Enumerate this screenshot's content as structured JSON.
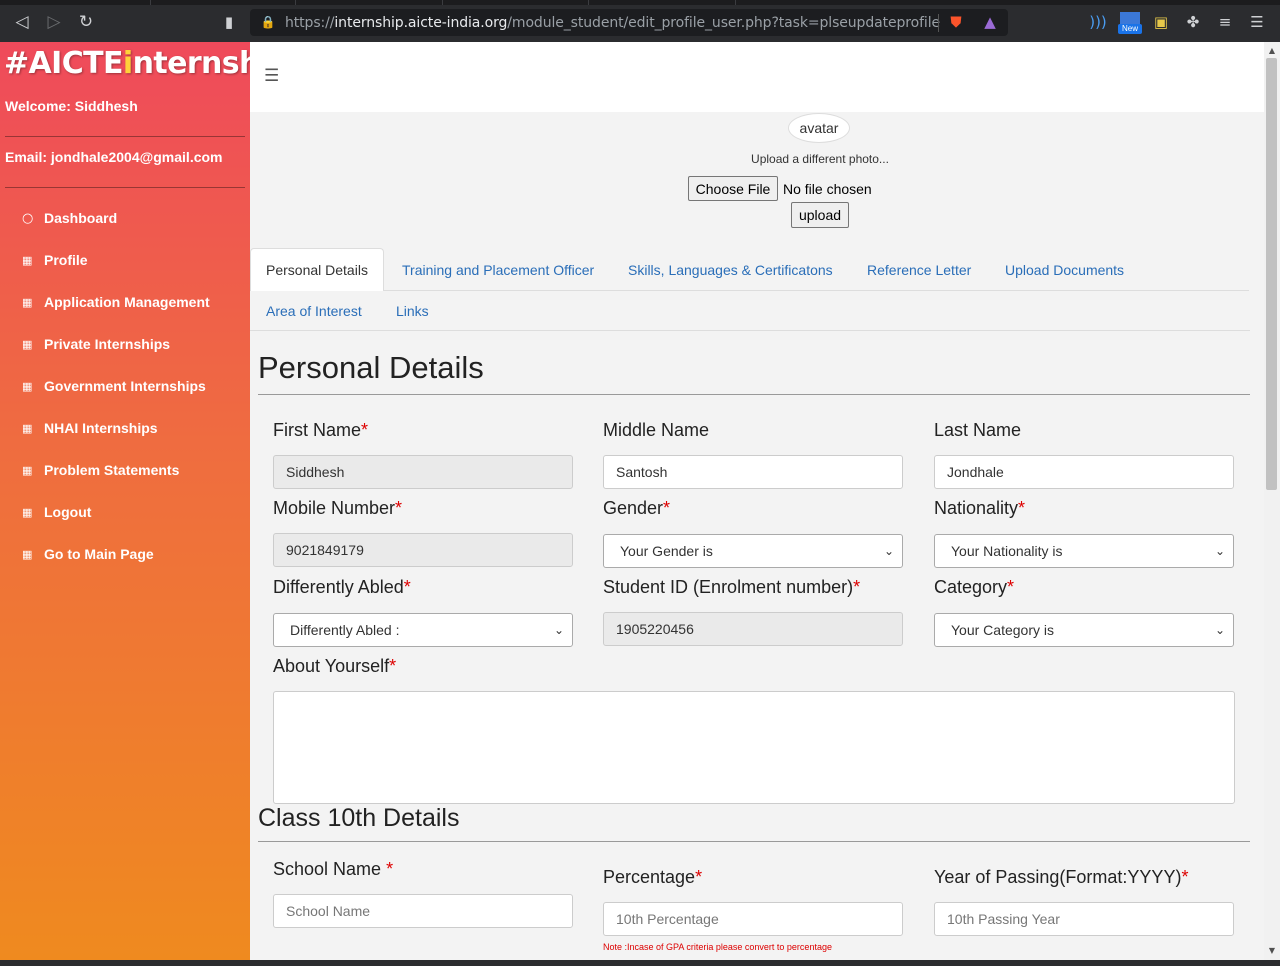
{
  "browser": {
    "url_scheme": "https://",
    "url_host": "internship.aicte-india.org",
    "url_path": "/module_student/edit_profile_user.php?task=plseupdateprofile",
    "ext_new_badge": "New"
  },
  "sidebar": {
    "logo_prefix": "#AICTE",
    "logo_i": "i",
    "logo_suffix": "nternship",
    "welcome": "Welcome: Siddhesh",
    "email": "Email: jondhale2004@gmail.com",
    "items": [
      {
        "label": "Dashboard"
      },
      {
        "label": "Profile"
      },
      {
        "label": "Application Management"
      },
      {
        "label": "Private Internships"
      },
      {
        "label": "Government Internships"
      },
      {
        "label": "NHAI Internships"
      },
      {
        "label": "Problem Statements"
      },
      {
        "label": "Logout"
      },
      {
        "label": "Go to Main Page"
      }
    ]
  },
  "profile": {
    "avatar_alt": "avatar",
    "upload_note": "Upload a different photo...",
    "choose_file": "Choose File",
    "no_file": "No file chosen",
    "upload": "upload"
  },
  "tabs": [
    {
      "label": "Personal Details",
      "active": true
    },
    {
      "label": "Training and Placement Officer"
    },
    {
      "label": "Skills, Languages & Certificatons"
    },
    {
      "label": "Reference Letter"
    },
    {
      "label": "Upload Documents"
    },
    {
      "label": "Area of Interest"
    },
    {
      "label": "Links"
    }
  ],
  "personal": {
    "heading": "Personal Details",
    "first_name_label": "First Name",
    "first_name": "Siddhesh",
    "middle_name_label": "Middle Name",
    "middle_name": "Santosh",
    "last_name_label": "Last Name",
    "last_name": "Jondhale",
    "mobile_label": "Mobile Number",
    "mobile": "9021849179",
    "gender_label": "Gender",
    "gender": "Your Gender is",
    "nationality_label": "Nationality",
    "nationality": "Your Nationality is",
    "abled_label": "Differently Abled",
    "abled": "Differently Abled :",
    "student_id_label": "Student ID (Enrolment number)",
    "student_id": "1905220456",
    "category_label": "Category",
    "category": "Your Category is",
    "about_label": "About Yourself",
    "required_mark": "*"
  },
  "class10": {
    "heading": "Class 10th Details",
    "school_label": "School Name ",
    "school_placeholder": "School Name",
    "percentage_label": "Percentage",
    "percentage_placeholder": "10th Percentage",
    "year_label": "Year of Passing(Format:YYYY)",
    "year_placeholder": "10th Passing Year",
    "note": "Note :Incase of GPA criteria please convert to percentage"
  }
}
